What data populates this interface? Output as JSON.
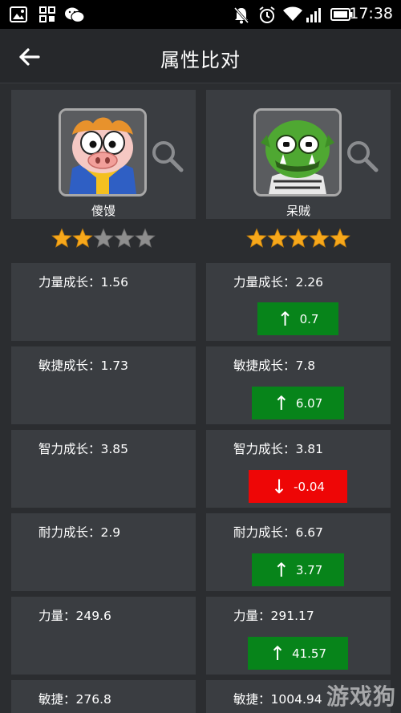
{
  "status_bar": {
    "time": "17:38",
    "left_icons": [
      "image-icon",
      "app-grid-icon",
      "wechat-icon"
    ],
    "right_icons": [
      "mute-icon",
      "alarm-icon",
      "wifi-icon",
      "signal-icon",
      "battery-icon"
    ]
  },
  "header": {
    "title": "属性比对",
    "back_icon": "arrow-left-icon"
  },
  "heroes": [
    {
      "name": "傻馒",
      "stars": 2,
      "max_stars": 5,
      "avatar": "pig-hero-portrait"
    },
    {
      "name": "呆贼",
      "stars": 5,
      "max_stars": 5,
      "avatar": "green-orc-portrait"
    }
  ],
  "stats": [
    {
      "left": "力量成长：1.56",
      "right": "力量成长：2.26",
      "diff": "0.7",
      "direction": "up"
    },
    {
      "left": "敏捷成长：1.73",
      "right": "敏捷成长：7.8",
      "diff": "6.07",
      "direction": "up"
    },
    {
      "left": "智力成长：3.85",
      "right": "智力成长：3.81",
      "diff": "-0.04",
      "direction": "down"
    },
    {
      "left": "耐力成长：2.9",
      "right": "耐力成长：6.67",
      "diff": "3.77",
      "direction": "up"
    },
    {
      "left": "力量：249.6",
      "right": "力量：291.17",
      "diff": "41.57",
      "direction": "up"
    },
    {
      "left": "敏捷：276.8",
      "right": "敏捷：1004.94"
    }
  ],
  "colors": {
    "up": "#07841a",
    "down": "#ee0606",
    "star_on": "#f7a81b",
    "star_off": "#8e8e8e"
  },
  "watermark": "游戏狗"
}
